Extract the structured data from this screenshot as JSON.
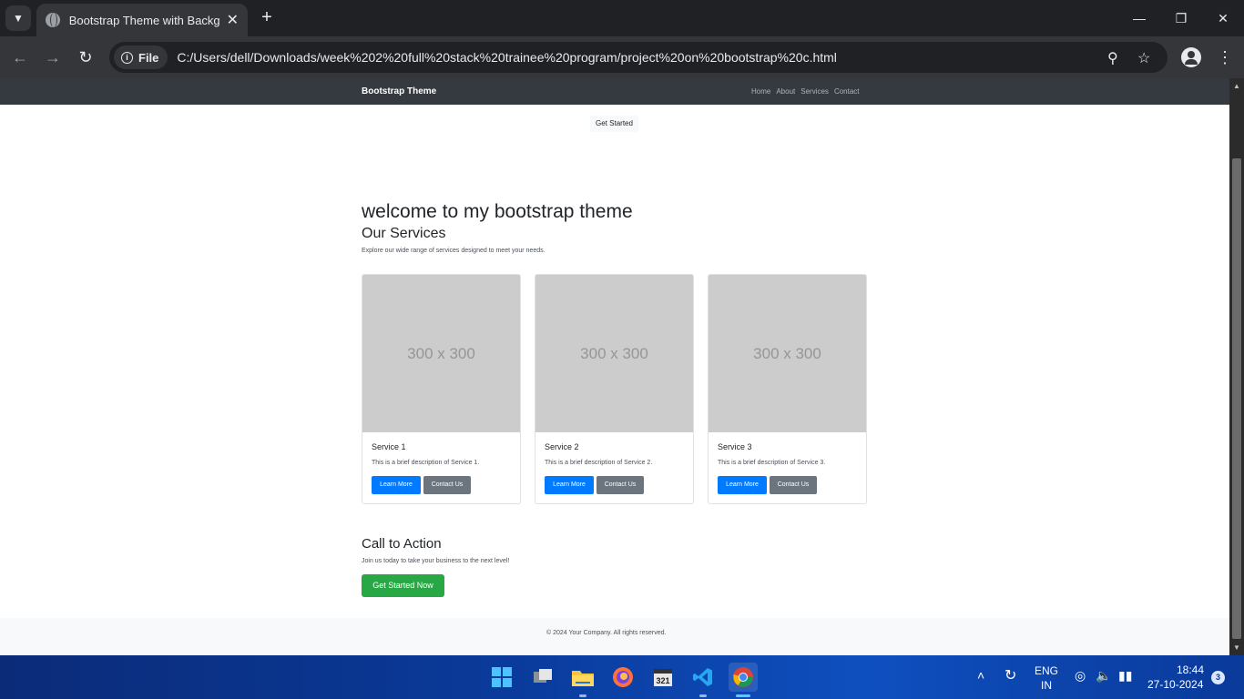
{
  "browser": {
    "tab_title": "Bootstrap Theme with Background",
    "url_scheme": "File",
    "url": "C:/Users/dell/Downloads/week%202%20full%20stack%20trainee%20program/project%20on%20bootstrap%20c.html"
  },
  "site": {
    "brand": "Bootstrap Theme",
    "nav": [
      "Home",
      "About",
      "Services",
      "Contact"
    ],
    "get_started": "Get Started",
    "hero_title": "welcome to my bootstrap theme",
    "services_title": "Our Services",
    "services_subtitle": "Explore our wide range of services designed to meet your needs.",
    "cards": [
      {
        "image_label": "300 x 300",
        "title": "Service 1",
        "desc": "This is a brief description of Service 1.",
        "primary": "Learn More",
        "secondary": "Contact Us"
      },
      {
        "image_label": "300 x 300",
        "title": "Service 2",
        "desc": "This is a brief description of Service 2.",
        "primary": "Learn More",
        "secondary": "Contact Us"
      },
      {
        "image_label": "300 x 300",
        "title": "Service 3",
        "desc": "This is a brief description of Service 3.",
        "primary": "Learn More",
        "secondary": "Contact Us"
      }
    ],
    "cta_title": "Call to Action",
    "cta_subtitle": "Join us today to take your business to the next level!",
    "cta_button": "Get Started Now",
    "footer": "© 2024 Your Company. All rights reserved."
  },
  "taskbar": {
    "lang_top": "ENG",
    "lang_bottom": "IN",
    "time": "18:44",
    "date": "27-10-2024",
    "notifications": "3",
    "apps": [
      "start-icon",
      "task-view-icon",
      "file-explorer-icon",
      "firefox-icon",
      "calendar-app-icon",
      "vscode-icon",
      "chrome-icon"
    ]
  },
  "colors": {
    "navbar": "#343a40",
    "primary": "#007bff",
    "secondary": "#6c757d",
    "success": "#28a745",
    "placeholder": "#cccccc"
  }
}
